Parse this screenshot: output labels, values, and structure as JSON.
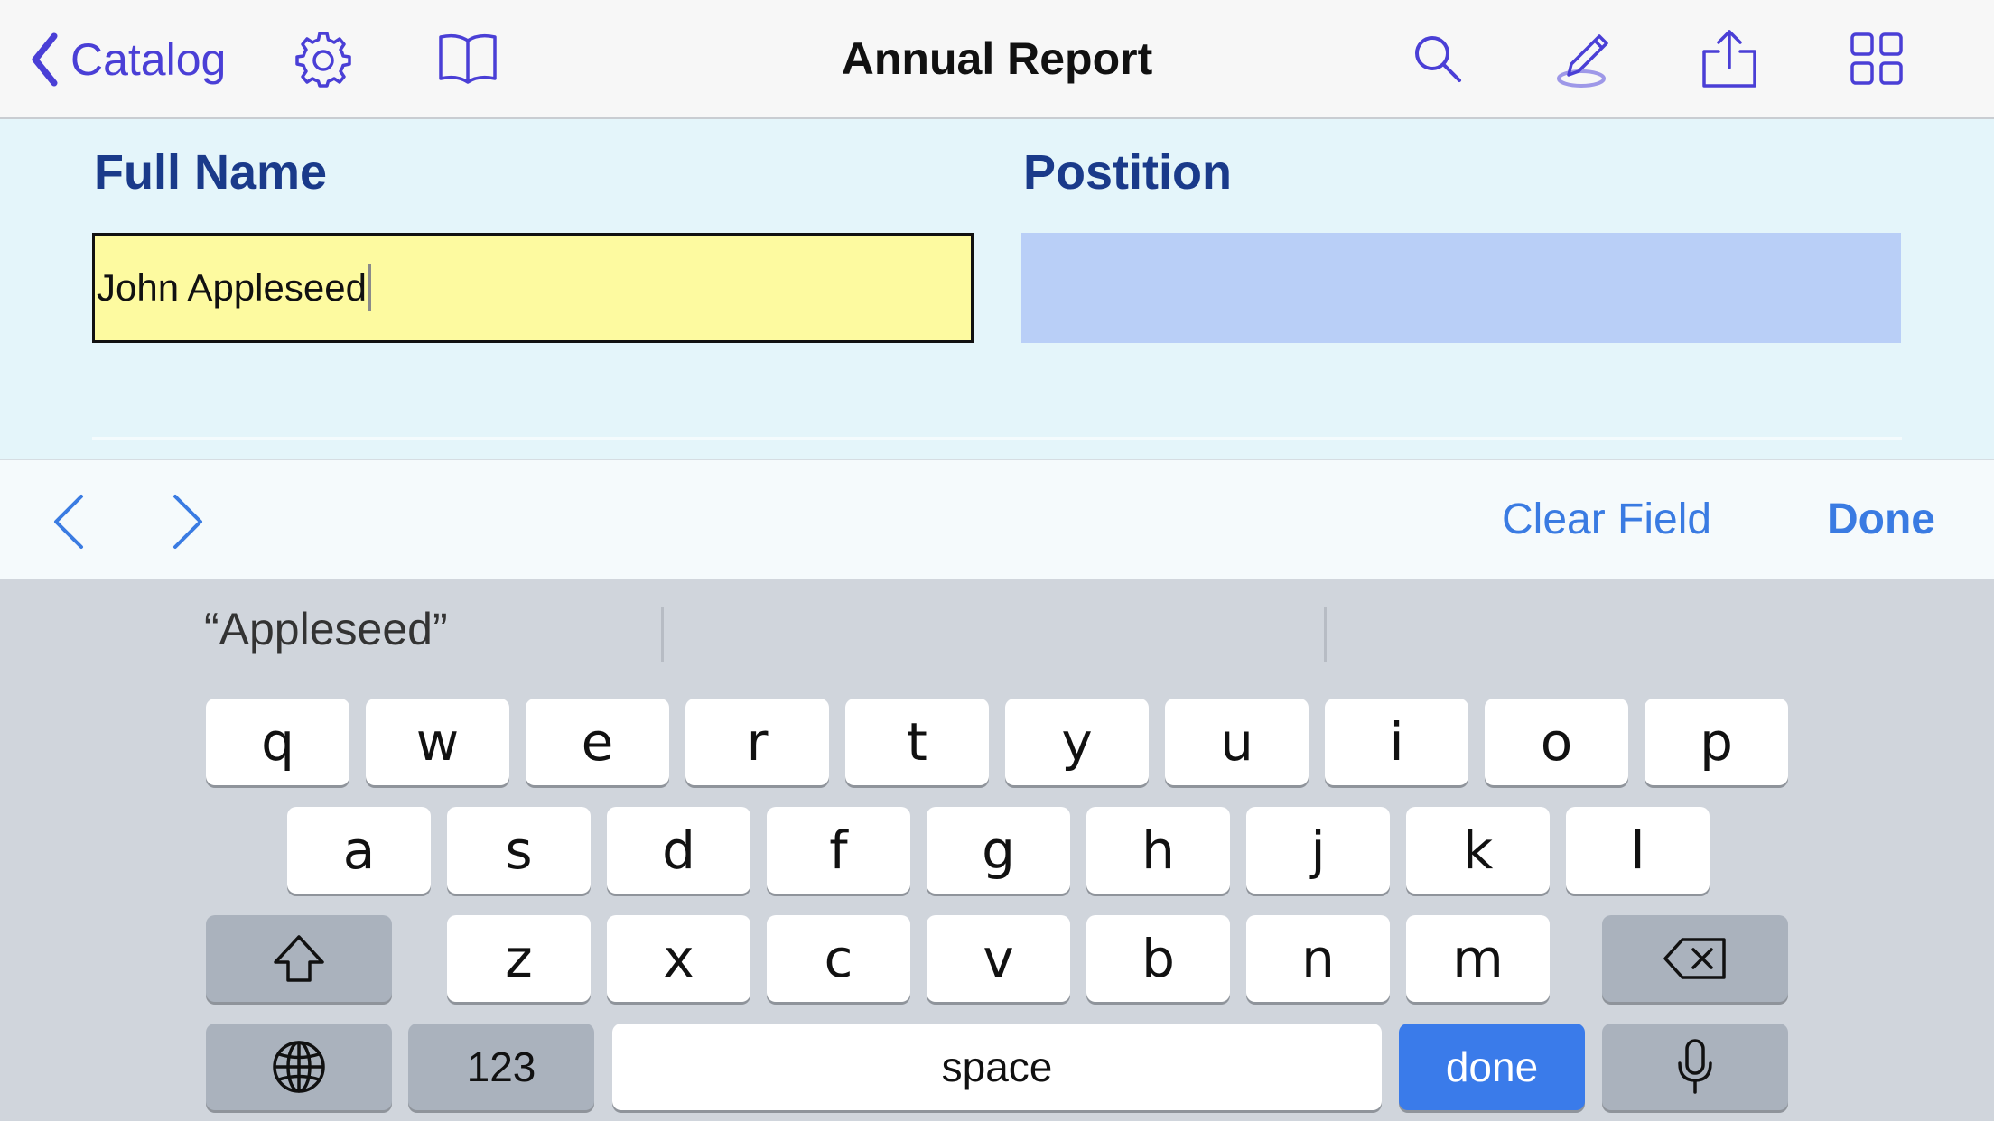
{
  "nav": {
    "back_label": "Catalog",
    "title": "Annual Report",
    "icons": [
      "chevron-left-icon",
      "gear-icon",
      "book-icon",
      "search-icon",
      "pen-icon",
      "share-icon",
      "grid-icon"
    ],
    "accent_color": "#4a3fd6"
  },
  "form": {
    "fields": [
      {
        "label": "Full Name",
        "value": "John Appleseed",
        "fill_color": "#fdfaa0",
        "focused": true
      },
      {
        "label": "Postition",
        "value": "",
        "fill_color": "#b9cff7",
        "focused": false
      }
    ]
  },
  "accessory": {
    "clear_label": "Clear Field",
    "done_label": "Done",
    "accent_color": "#3a7be2"
  },
  "keyboard": {
    "suggestions": [
      "“Appleseed”",
      "",
      ""
    ],
    "row1": [
      "q",
      "w",
      "e",
      "r",
      "t",
      "y",
      "u",
      "i",
      "o",
      "p"
    ],
    "row2": [
      "a",
      "s",
      "d",
      "f",
      "g",
      "h",
      "j",
      "k",
      "l"
    ],
    "row3": [
      "z",
      "x",
      "c",
      "v",
      "b",
      "n",
      "m"
    ],
    "numbers_label": "123",
    "space_label": "space",
    "return_label": "done",
    "return_color": "#3a7bea"
  }
}
